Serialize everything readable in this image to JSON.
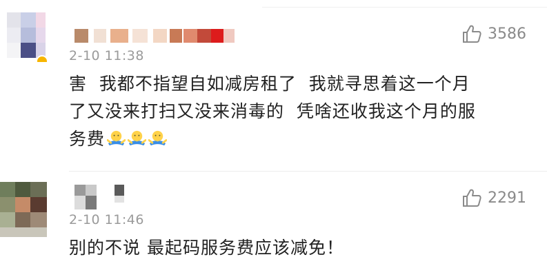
{
  "comments": [
    {
      "time": "2-10 11:38",
      "text_line1": "害  我都不指望自如减房租了  我就寻思着这一个月",
      "text_line2": "了又没来打扫又没来消毒的  凭啥还收我这个月的服",
      "text_line3": "务费",
      "emoji": [
        "shrug-emoji",
        "shrug-emoji",
        "shrug-emoji"
      ],
      "like_count": "3586",
      "like_icon": "thumbs-up-icon"
    },
    {
      "time": "2-10 11:46",
      "text": "别的不说 最起码服务费应该减免！",
      "like_count": "2291",
      "like_icon": "thumbs-up-icon"
    }
  ],
  "colors": {
    "text": "#222222",
    "meta": "#9a9a9a",
    "like": "#8a8a8a",
    "divider": "#ececec"
  }
}
